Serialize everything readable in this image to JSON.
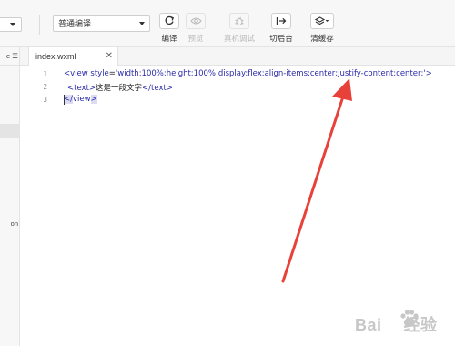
{
  "toolbar": {
    "mode_select": "普通编译",
    "tools": [
      {
        "id": "compile",
        "label": "编译",
        "icon": "refresh-icon",
        "enabled": true
      },
      {
        "id": "preview",
        "label": "预览",
        "icon": "eye-icon",
        "enabled": false
      },
      {
        "id": "remote-debug",
        "label": "真机调试",
        "icon": "bug-icon",
        "enabled": false
      },
      {
        "id": "switch-backend",
        "label": "切后台",
        "icon": "switch-arrow-icon",
        "enabled": true
      },
      {
        "id": "clear-cache",
        "label": "清缓存",
        "icon": "layers-icon",
        "enabled": true
      }
    ]
  },
  "sidebar": {
    "header_fragment": "e ☰",
    "text_fragment": "on"
  },
  "editor": {
    "tab": {
      "filename": "index.wxml",
      "close_icon": "✕"
    },
    "lines": [
      {
        "number": "1"
      },
      {
        "number": "2"
      },
      {
        "number": "3"
      }
    ],
    "line1": {
      "open": "<view ",
      "attr": "style",
      "eq": "=",
      "value": "'width:100%;height:100%;display:flex;align-items:center;justify-content:center;'",
      "close": ">"
    },
    "line2": {
      "open": "<text>",
      "content": "这是一段文字",
      "close": "</text>"
    },
    "line3": {
      "open": "</",
      "name": "view",
      "close": ">"
    }
  },
  "annotation": {
    "arrow_color": "#e8413a"
  },
  "watermark": {
    "text_left": "Bai",
    "text_right": "经验"
  }
}
